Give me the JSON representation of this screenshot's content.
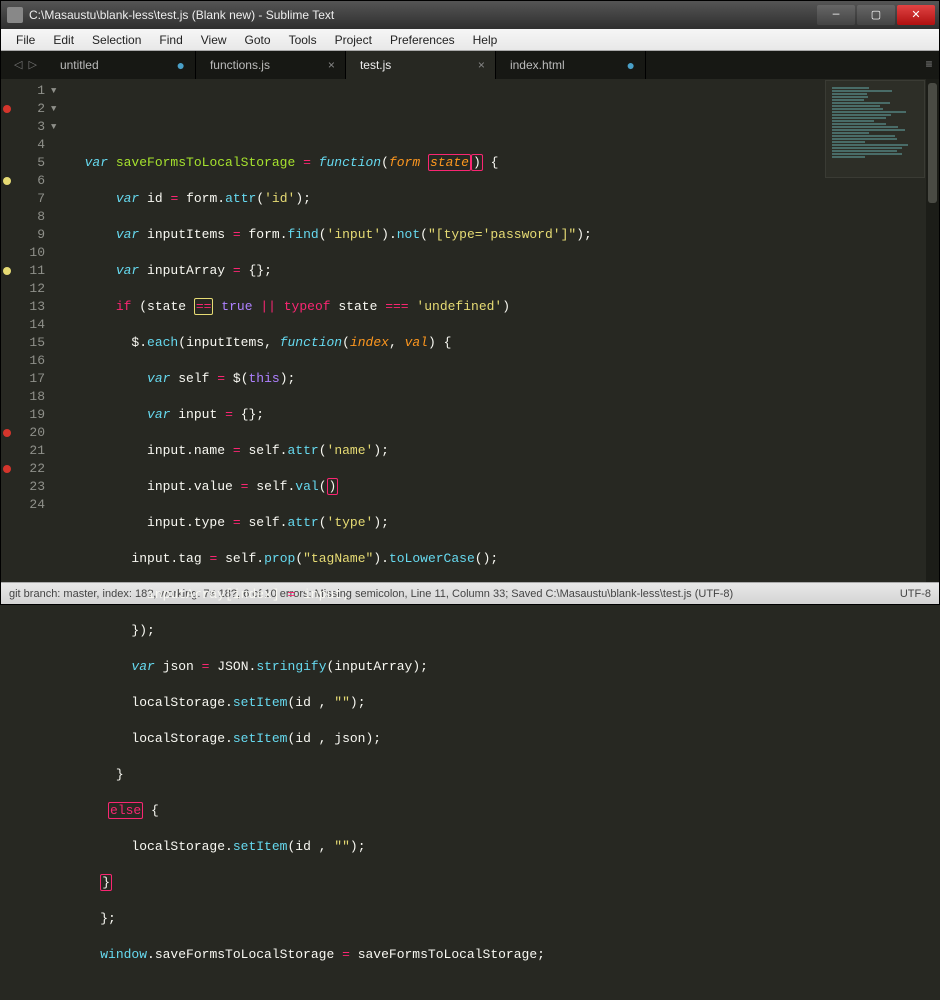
{
  "window": {
    "title": "C:\\Masaustu\\blank-less\\test.js (Blank new) - Sublime Text"
  },
  "menu": [
    "File",
    "Edit",
    "Selection",
    "Find",
    "View",
    "Goto",
    "Tools",
    "Project",
    "Preferences",
    "Help"
  ],
  "tabs": [
    {
      "label": "untitled",
      "dirty": true,
      "active": false
    },
    {
      "label": "functions.js",
      "dirty": false,
      "active": false
    },
    {
      "label": "test.js",
      "dirty": false,
      "active": true
    },
    {
      "label": "index.html",
      "dirty": true,
      "active": false
    }
  ],
  "gutter": {
    "lines": [
      "1",
      "2",
      "3",
      "4",
      "5",
      "6",
      "7",
      "8",
      "9",
      "10",
      "11",
      "12",
      "13",
      "14",
      "15",
      "16",
      "17",
      "18",
      "19",
      "20",
      "21",
      "22",
      "23",
      "24"
    ],
    "folds": {
      "2": "▼",
      "6": "▼",
      "7": "▼"
    },
    "markers": [
      {
        "line": 2,
        "color": "red"
      },
      {
        "line": 6,
        "color": "yellow"
      },
      {
        "line": 11,
        "color": "yellow"
      },
      {
        "line": 20,
        "color": "red"
      },
      {
        "line": 22,
        "color": "red"
      }
    ]
  },
  "code": [
    "",
    "var saveFormsToLocalStorage = function(form state) {",
    "    var id = form.attr('id');",
    "    var inputItems = form.find('input').not(\"[type='password']\");",
    "    var inputArray = {};",
    "    if (state == true || typeof state === 'undefined')",
    "      $.each(inputItems, function(index, val) {",
    "        var self = $(this);",
    "        var input = {};",
    "        input.name = self.attr('name');",
    "        input.value = self.val()",
    "        input.type = self.attr('type');",
    "      input.tag = self.prop(\"tagName\").toLowerCase();",
    "        inputArray[index] = input;",
    "      });",
    "      var json = JSON.stringify(inputArray);",
    "      localStorage.setItem(id , \"\");",
    "      localStorage.setItem(id , json);",
    "    }",
    "   else {",
    "      localStorage.setItem(id , \"\");",
    "    }",
    "  };",
    "  window.saveFormsToLocalStorage = saveFormsToLocalStorage;"
  ],
  "status": {
    "left": "git branch: master, index: 18?, working: 7≠ 18?, 6 of 10 errors: Missing semicolon, Line 11, Column 33; Saved C:\\Masaustu\\blank-less\\test.js (UTF-8)",
    "right": "UTF-8"
  }
}
